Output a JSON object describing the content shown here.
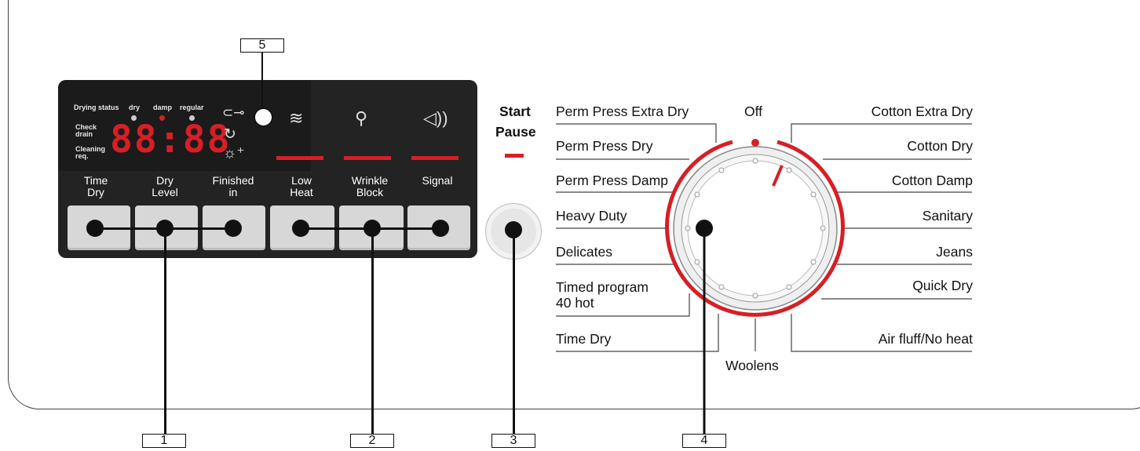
{
  "colors": {
    "accent_red": "#d61f26",
    "panel_dark": "#232323",
    "button_gray": "#d7d7d7"
  },
  "display": {
    "drying_status": "Drying status",
    "dry": "dry",
    "damp": "damp",
    "regular": "regular",
    "check_drain": "Check\ndrain",
    "cleaning_req": "Cleaning\nreq.",
    "digits": "88:88"
  },
  "icons": {
    "child_lock": "key-icon",
    "timer": "clock-icon",
    "brightness": "sun-plus-icon",
    "low_heat": "feather-icon",
    "wrinkle": "shirt-icon",
    "signal": "speaker-icon"
  },
  "buttons": [
    {
      "label": "Time\nDry"
    },
    {
      "label": "Dry\nLevel"
    },
    {
      "label": "Finished\nin"
    },
    {
      "label": "Low\nHeat"
    },
    {
      "label": "Wrinkle\nBlock"
    },
    {
      "label": "Signal"
    }
  ],
  "start_pause": {
    "start": "Start",
    "pause": "Pause"
  },
  "programs_left": [
    "Perm Press Extra Dry",
    "Perm Press Dry",
    "Perm Press Damp",
    "Heavy Duty",
    "Delicates",
    "Timed program\n40 hot",
    "Time Dry"
  ],
  "programs_right": [
    "Cotton Extra Dry",
    "Cotton Dry",
    "Cotton Damp",
    "Sanitary",
    "Jeans",
    "Quick Dry",
    "Air fluff/No heat"
  ],
  "program_off": "Off",
  "program_bottom": "Woolens",
  "callouts": {
    "c1": "1",
    "c2": "2",
    "c3": "3",
    "c4": "4",
    "c5": "5"
  }
}
